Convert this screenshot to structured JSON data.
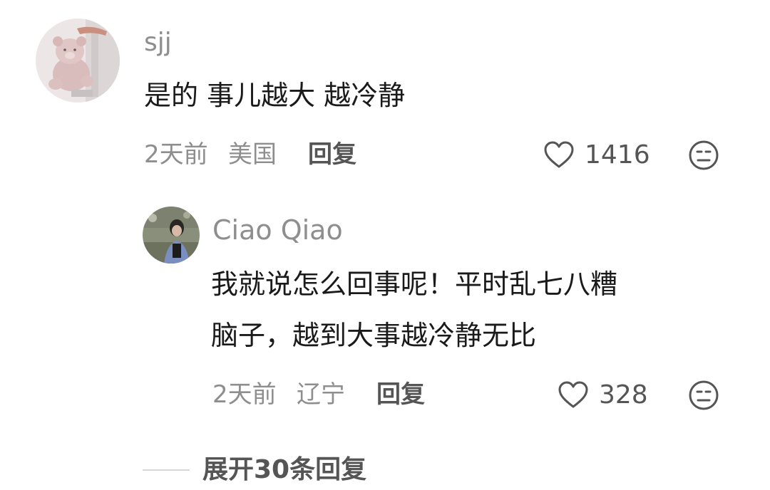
{
  "comments": [
    {
      "author": "sjj",
      "text": "是的 事儿越大 越冷静",
      "time": "2天前",
      "location": "美国",
      "reply_label": "回复",
      "likes": "1416",
      "avatar_icon": "teddy-bear-avatar"
    }
  ],
  "replies": [
    {
      "author": "Ciao Qiao",
      "text_line1": "我就说怎么回事呢！平时乱七八糟",
      "text_line2": "脑子，越到大事越冷静无比",
      "time": "2天前",
      "location": "辽宁",
      "reply_label": "回复",
      "likes": "328",
      "avatar_icon": "person-photo-avatar"
    }
  ],
  "expand": {
    "label": "展开30条回复"
  },
  "icons": {
    "like": "heart-outline-icon",
    "dislike": "neutral-face-icon"
  },
  "colors": {
    "name": "#8e8e8e",
    "text": "#1a1a1a",
    "meta": "#8e8e8e",
    "action": "#555555"
  }
}
